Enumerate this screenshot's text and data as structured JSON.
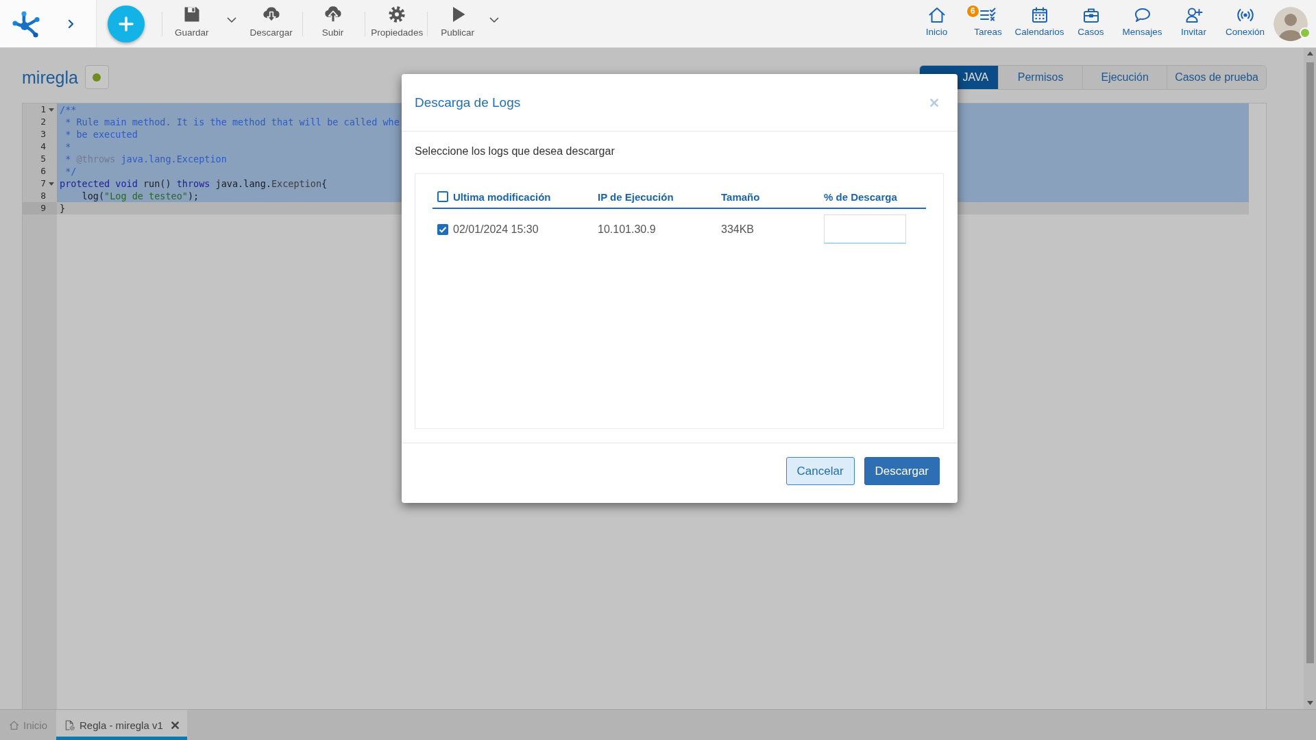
{
  "toolbar": [
    {
      "kind": "save",
      "label": "Guardar",
      "dropdown": true,
      "separator_before": true
    },
    {
      "kind": "download",
      "label": "Descargar",
      "dropdown": false,
      "separator_before": false
    },
    {
      "kind": "upload",
      "label": "Subir",
      "dropdown": false,
      "separator_before": true
    },
    {
      "kind": "properties",
      "label": "Propiedades",
      "dropdown": false,
      "separator_before": true
    },
    {
      "kind": "publish",
      "label": "Publicar",
      "dropdown": true,
      "separator_before": true
    }
  ],
  "nav": [
    {
      "kind": "home",
      "label": "Inicio"
    },
    {
      "kind": "tasks",
      "label": "Tareas",
      "badge": "6"
    },
    {
      "kind": "calendar",
      "label": "Calendarios"
    },
    {
      "kind": "cases",
      "label": "Casos"
    },
    {
      "kind": "messages",
      "label": "Mensajes"
    },
    {
      "kind": "invite",
      "label": "Invitar"
    },
    {
      "kind": "connection",
      "label": "Conexión"
    }
  ],
  "user": {
    "online": true
  },
  "page": {
    "title": "miregla",
    "rule_status": {
      "active": true
    },
    "tabs": [
      {
        "label": "JAVA",
        "selected": true
      },
      {
        "label": "Permisos",
        "selected": false
      },
      {
        "label": "Ejecución",
        "selected": false
      },
      {
        "label": "Casos de prueba",
        "selected": false
      }
    ]
  },
  "editor": {
    "lines": [
      {
        "number": "1",
        "foldable": true,
        "selected": true,
        "active": false,
        "tokens": [
          {
            "kind": "comment",
            "text": "/**"
          }
        ]
      },
      {
        "number": "2",
        "foldable": false,
        "selected": true,
        "active": false,
        "tokens": [
          {
            "kind": "comment",
            "text": " * Rule main method. It is the method that will be called whe"
          }
        ]
      },
      {
        "number": "3",
        "foldable": false,
        "selected": true,
        "active": false,
        "tokens": [
          {
            "kind": "comment",
            "text": " * be executed"
          }
        ]
      },
      {
        "number": "4",
        "foldable": false,
        "selected": true,
        "active": false,
        "tokens": [
          {
            "kind": "comment",
            "text": " *"
          }
        ]
      },
      {
        "number": "5",
        "foldable": false,
        "selected": true,
        "active": false,
        "tokens": [
          {
            "kind": "comment",
            "text": " * "
          },
          {
            "kind": "doctag",
            "text": "@throws"
          },
          {
            "kind": "comment",
            "text": " java.lang.Exception"
          }
        ]
      },
      {
        "number": "6",
        "foldable": false,
        "selected": true,
        "active": false,
        "tokens": [
          {
            "kind": "comment",
            "text": " */"
          }
        ]
      },
      {
        "number": "7",
        "foldable": true,
        "selected": true,
        "active": false,
        "tokens": [
          {
            "kind": "keyword",
            "text": "protected void"
          },
          {
            "kind": "plain",
            "text": " run() "
          },
          {
            "kind": "keyword",
            "text": "throws"
          },
          {
            "kind": "plain",
            "text": " java.lang."
          },
          {
            "kind": "type",
            "text": "Exception"
          },
          {
            "kind": "plain",
            "text": "{"
          }
        ]
      },
      {
        "number": "8",
        "foldable": false,
        "selected": true,
        "active": false,
        "tokens": [
          {
            "kind": "plain",
            "text": "    log("
          },
          {
            "kind": "string",
            "text": "\"Log de testeo\""
          },
          {
            "kind": "plain",
            "text": ");"
          }
        ]
      },
      {
        "number": "9",
        "foldable": false,
        "selected": false,
        "active": true,
        "tokens": [
          {
            "kind": "plain",
            "text": "}"
          }
        ]
      }
    ]
  },
  "dialog": {
    "title": "Descarga de Logs",
    "instruction": "Seleccione los logs que desea descargar",
    "table": {
      "select_all": {
        "checked": false
      },
      "columns": [
        "Ultima modificación",
        "IP de Ejecución",
        "Tamaño",
        "% de Descarga"
      ],
      "rows": [
        {
          "checked": true,
          "cells": [
            "02/01/2024 15:30",
            "10.101.30.9",
            "334KB"
          ]
        }
      ]
    },
    "buttons": [
      {
        "kind": "secondary",
        "label": "Cancelar"
      },
      {
        "kind": "primary",
        "label": "Descargar"
      }
    ]
  },
  "bottom_tabs": [
    {
      "kind": "home",
      "label": "Inicio",
      "selected": false,
      "closable": false
    },
    {
      "kind": "rule",
      "label": "Regla - miregla v1",
      "selected": true,
      "closable": true
    }
  ]
}
